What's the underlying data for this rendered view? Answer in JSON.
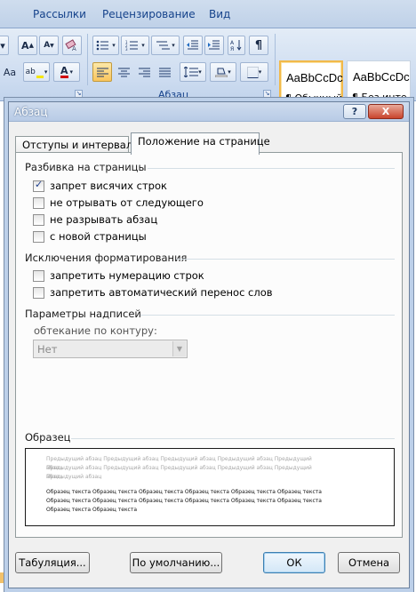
{
  "ribbon": {
    "tabs": [
      "Рассылки",
      "Рецензирование",
      "Вид"
    ],
    "group_paragraph_label": "Абзац",
    "styles": [
      {
        "sample": "AaBbCcDc",
        "name": "¶ Обычный",
        "selected": true
      },
      {
        "sample": "AaBbCcDc",
        "name": "¶ Без инте...",
        "selected": false
      }
    ],
    "left_fragment": "Aa"
  },
  "dialog": {
    "title": "Абзац",
    "help_label": "?",
    "close_label": "X",
    "tabs": [
      {
        "label": "Отступы и интервалы",
        "active": false
      },
      {
        "label": "Положение на странице",
        "active": true
      }
    ],
    "pagination": {
      "heading": "Разбивка на страницы",
      "options": [
        {
          "label": "запрет висячих строк",
          "checked": true
        },
        {
          "label": "не отрывать от следующего",
          "checked": false
        },
        {
          "label": "не разрывать абзац",
          "checked": false
        },
        {
          "label": "с новой страницы",
          "checked": false
        }
      ]
    },
    "formatting": {
      "heading": "Исключения форматирования",
      "options": [
        {
          "label": "запретить нумерацию строк",
          "checked": false
        },
        {
          "label": "запретить автоматический перенос слов",
          "checked": false
        }
      ]
    },
    "textbox": {
      "heading": "Параметры надписей",
      "wrap_label": "обтекание по контуру:",
      "wrap_value": "Нет"
    },
    "preview": {
      "heading": "Образец",
      "previous_lines": [
        "Предыдущий абзац Предыдущий абзац Предыдущий абзац Предыдущий абзац Предыдущий абзац",
        "Предыдущий абзац Предыдущий абзац Предыдущий абзац Предыдущий абзац Предыдущий абзац",
        "Предыдущий абзац"
      ],
      "current_lines": [
        "Образец текста Образец текста Образец текста Образец текста Образец текста Образец текста",
        "Образец текста Образец текста Образец текста Образец текста Образец текста Образец текста",
        "Образец текста Образец текста"
      ]
    },
    "buttons": {
      "tabs": "Табуляция...",
      "default": "По умолчанию...",
      "ok": "ОК",
      "cancel": "Отмена"
    }
  },
  "colors": {
    "ribbon_text": "#15428b",
    "highlight_yellow": "#f5e600",
    "font_color_red": "#d00000",
    "active_button": "#f9c55d",
    "checkmark": "#1b3b8a"
  }
}
